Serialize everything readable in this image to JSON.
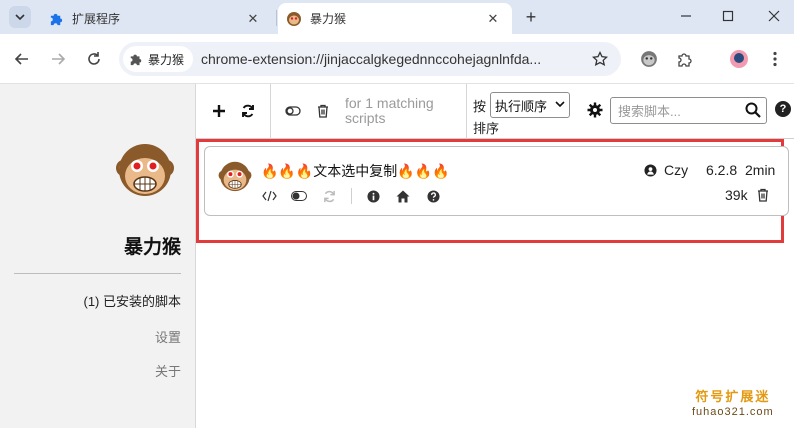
{
  "browser": {
    "tabs": [
      {
        "title": "扩展程序",
        "icon": "puzzle-icon",
        "active": false
      },
      {
        "title": "暴力猴",
        "icon": "monkey-icon",
        "active": true
      }
    ],
    "new_tab_label": "+",
    "address": {
      "site_chip": "暴力猴",
      "url": "chrome-extension://jinjaccalgkegednnccohejagnlnfda..."
    }
  },
  "sidebar": {
    "title": "暴力猴",
    "items": [
      {
        "label": "(1) 已安装的脚本",
        "active": true
      },
      {
        "label": "设置",
        "active": false
      },
      {
        "label": "关于",
        "active": false
      }
    ]
  },
  "toolbar": {
    "filter_text": "for 1 matching scripts",
    "sort_prefix": "按",
    "sort_value": "执行顺序",
    "sort_suffix": "排序",
    "search_placeholder": "搜索脚本...",
    "help_label": "?"
  },
  "script": {
    "name": "🔥🔥🔥文本选中复制🔥🔥🔥",
    "author": "Czy",
    "version": "6.2.8",
    "updated": "2min",
    "size": "39k",
    "enabled": true
  },
  "watermark": {
    "title": "符号扩展迷",
    "url": "fuhao321.com"
  },
  "colors": {
    "tabstrip": "#dfe6f3",
    "sidebar_bg": "#f2f2f2",
    "highlight": "#e33b3b",
    "monkey_brown": "#8b5a2b",
    "monkey_face": "#e9b98a"
  }
}
